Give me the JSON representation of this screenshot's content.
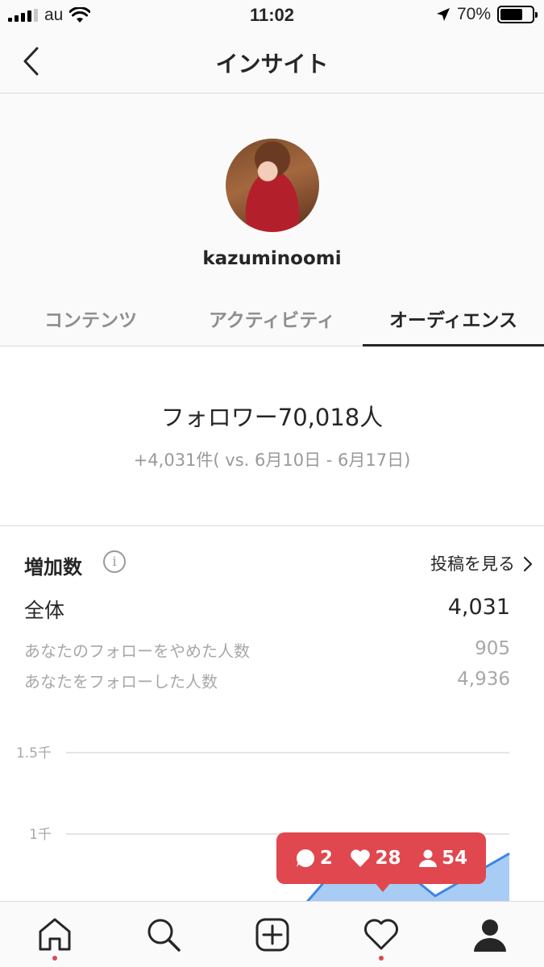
{
  "status_bar": {
    "carrier": "au",
    "time": "11:02",
    "battery": "70%",
    "battery_level": 0.7
  },
  "header": {
    "title": "インサイト"
  },
  "profile": {
    "username": "kazuminoomi"
  },
  "tabs": [
    {
      "label": "コンテンツ",
      "active": false
    },
    {
      "label": "アクティビティ",
      "active": false
    },
    {
      "label": "オーディエンス",
      "active": true
    }
  ],
  "summary": {
    "followers_total": "フォロワー70,018人",
    "change": "+4,031件( vs. 6月10日 - 6月17日)"
  },
  "growth": {
    "title": "増加数",
    "view_posts": "投稿を見る",
    "rows": [
      {
        "label": "全体",
        "value": "4,031"
      },
      {
        "label": "あなたのフォローをやめた人数",
        "value": "905"
      },
      {
        "label": "あなたをフォローした人数",
        "value": "4,936"
      }
    ]
  },
  "chart_data": {
    "type": "area",
    "y_ticks": [
      "1.5千",
      "1千"
    ],
    "ylim": [
      0,
      1500
    ],
    "series": [
      {
        "values": [
          520,
          980,
          620,
          880
        ]
      }
    ],
    "colors": {
      "fill": "#a9ccf4",
      "line": "#3b87e4",
      "grid": "#dbdbdb"
    }
  },
  "notification": {
    "comments": "2",
    "likes": "28",
    "followers": "54",
    "color": "#e0474f"
  }
}
